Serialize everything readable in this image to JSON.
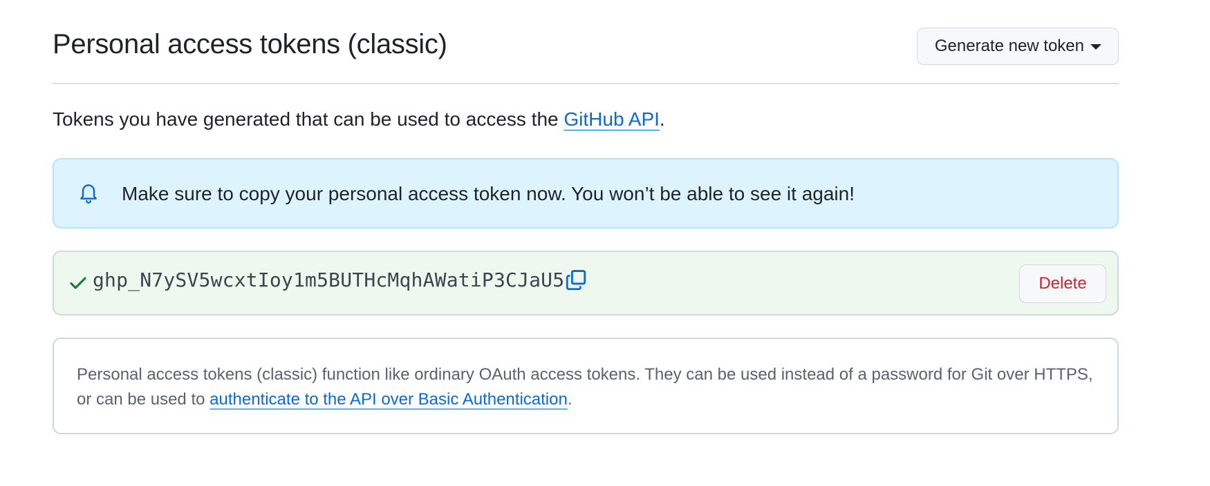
{
  "header": {
    "title": "Personal access tokens (classic)",
    "generate_button_label": "Generate new token"
  },
  "intro": {
    "text": "Tokens you have generated that can be used to access the ",
    "link_label": "GitHub API",
    "suffix": "."
  },
  "flash": {
    "icon": "bell-icon",
    "message": "Make sure to copy your personal access token now. You won’t be able to see it again!"
  },
  "token": {
    "status_icon": "check-icon",
    "value": "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",
    "copy_icon": "copy-icon",
    "delete_label": "Delete"
  },
  "note": {
    "text": "Personal access tokens (classic) function like ordinary OAuth access tokens. They can be used instead of a password for Git over HTTPS, or can be used to ",
    "link_label": "authenticate to the API over Basic Authentication",
    "suffix": "."
  },
  "colors": {
    "link": "#0969da",
    "flash_bg": "#ddf4ff",
    "token_bg": "#eff8ee",
    "success": "#1a7f37",
    "danger": "#cf222e"
  }
}
